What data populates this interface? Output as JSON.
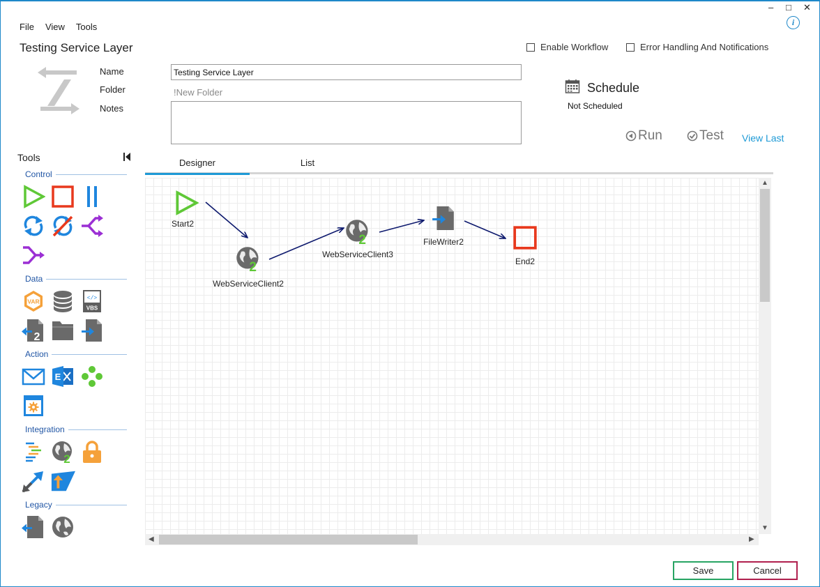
{
  "window": {
    "minimize": "–",
    "maximize": "□",
    "close": "✕",
    "info": "i"
  },
  "menu": {
    "items": [
      "File",
      "View",
      "Tools"
    ]
  },
  "app": {
    "title": "Testing Service Layer"
  },
  "options": {
    "enable_workflow": "Enable Workflow",
    "error_handling": "Error Handling And Notifications"
  },
  "form": {
    "name_label": "Name",
    "folder_label": "Folder",
    "notes_label": "Notes",
    "name_value": "Testing Service Layer",
    "folder_value": "!New Folder",
    "notes_value": ""
  },
  "schedule": {
    "title": "Schedule",
    "status": "Not Scheduled"
  },
  "actions": {
    "run": "Run",
    "test": "Test",
    "view_last": "View Last"
  },
  "tools_panel": {
    "title": "Tools",
    "sections": {
      "control": "Control",
      "data": "Data",
      "action": "Action",
      "integration": "Integration",
      "legacy": "Legacy"
    },
    "data_badges": {
      "var": "VAR",
      "vbs": "VBS",
      "vbs_tag": "</>"
    }
  },
  "tabs": {
    "designer": "Designer",
    "list": "List"
  },
  "workflow": {
    "nodes": [
      "Start2",
      "WebServiceClient2",
      "WebServiceClient3",
      "FileWriter2",
      "End2"
    ]
  },
  "footer": {
    "save": "Save",
    "cancel": "Cancel"
  },
  "colors": {
    "accent": "#1e9ad6",
    "start": "#5fc837",
    "end": "#e8391d",
    "pause": "#1f86de",
    "branch": "#9b2fd4",
    "save_border": "#27a463",
    "cancel_border": "#b0204e"
  }
}
